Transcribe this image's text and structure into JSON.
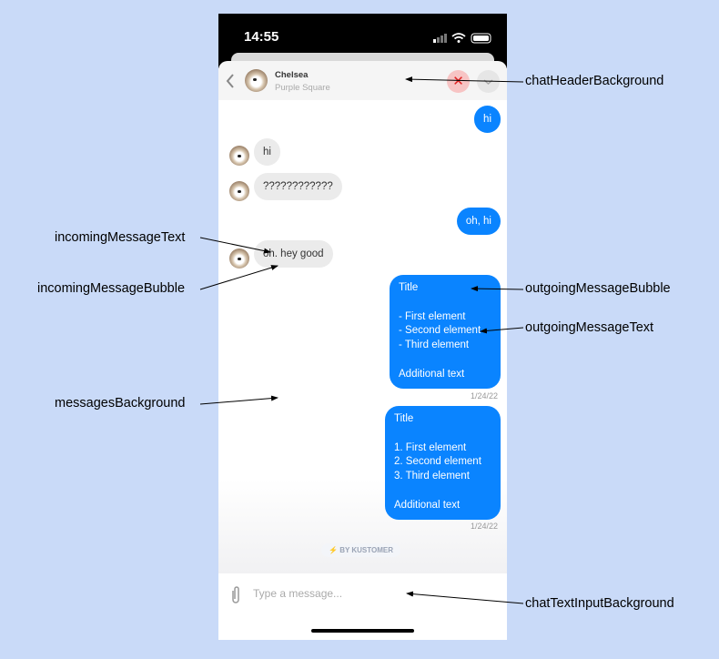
{
  "status": {
    "time": "14:55"
  },
  "header": {
    "name": "Chelsea",
    "subtitle": "Purple Square"
  },
  "messages": [
    {
      "dir": "out",
      "text": "hi"
    },
    {
      "dir": "in",
      "text": "hi"
    },
    {
      "dir": "in",
      "text": "????????????"
    },
    {
      "dir": "out",
      "text": "oh, hi"
    },
    {
      "dir": "in",
      "text": "oh. hey good"
    },
    {
      "dir": "out",
      "text": "Title\n\n- First element\n- Second element\n- Third element\n\nAdditional text",
      "time": "1/24/22"
    },
    {
      "dir": "out",
      "text": "Title\n\n1. First element\n2. Second element\n3. Third element\n\nAdditional text",
      "time": "1/24/22"
    }
  ],
  "branding": "BY KUSTOMER",
  "input": {
    "placeholder": "Type a message..."
  },
  "annotations": {
    "header": "chatHeaderBackground",
    "incomingText": "incomingMessageText",
    "incomingBubble": "incomingMessageBubble",
    "outgoingBubble": "outgoingMessageBubble",
    "outgoingText": "outgoingMessageText",
    "messagesBg": "messagesBackground",
    "inputBg": "chatTextInputBackground"
  },
  "colors": {
    "outgoing": "#0a84ff",
    "incoming": "#ebebeb",
    "background": "#c9daf8"
  }
}
